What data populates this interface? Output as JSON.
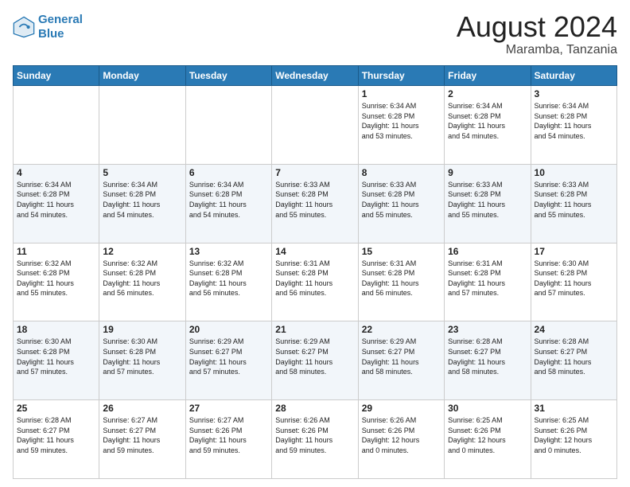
{
  "logo": {
    "line1": "General",
    "line2": "Blue"
  },
  "title": "August 2024",
  "location": "Maramba, Tanzania",
  "weekdays": [
    "Sunday",
    "Monday",
    "Tuesday",
    "Wednesday",
    "Thursday",
    "Friday",
    "Saturday"
  ],
  "weeks": [
    [
      {
        "day": "",
        "content": ""
      },
      {
        "day": "",
        "content": ""
      },
      {
        "day": "",
        "content": ""
      },
      {
        "day": "",
        "content": ""
      },
      {
        "day": "1",
        "content": "Sunrise: 6:34 AM\nSunset: 6:28 PM\nDaylight: 11 hours\nand 53 minutes."
      },
      {
        "day": "2",
        "content": "Sunrise: 6:34 AM\nSunset: 6:28 PM\nDaylight: 11 hours\nand 54 minutes."
      },
      {
        "day": "3",
        "content": "Sunrise: 6:34 AM\nSunset: 6:28 PM\nDaylight: 11 hours\nand 54 minutes."
      }
    ],
    [
      {
        "day": "4",
        "content": "Sunrise: 6:34 AM\nSunset: 6:28 PM\nDaylight: 11 hours\nand 54 minutes."
      },
      {
        "day": "5",
        "content": "Sunrise: 6:34 AM\nSunset: 6:28 PM\nDaylight: 11 hours\nand 54 minutes."
      },
      {
        "day": "6",
        "content": "Sunrise: 6:34 AM\nSunset: 6:28 PM\nDaylight: 11 hours\nand 54 minutes."
      },
      {
        "day": "7",
        "content": "Sunrise: 6:33 AM\nSunset: 6:28 PM\nDaylight: 11 hours\nand 55 minutes."
      },
      {
        "day": "8",
        "content": "Sunrise: 6:33 AM\nSunset: 6:28 PM\nDaylight: 11 hours\nand 55 minutes."
      },
      {
        "day": "9",
        "content": "Sunrise: 6:33 AM\nSunset: 6:28 PM\nDaylight: 11 hours\nand 55 minutes."
      },
      {
        "day": "10",
        "content": "Sunrise: 6:33 AM\nSunset: 6:28 PM\nDaylight: 11 hours\nand 55 minutes."
      }
    ],
    [
      {
        "day": "11",
        "content": "Sunrise: 6:32 AM\nSunset: 6:28 PM\nDaylight: 11 hours\nand 55 minutes."
      },
      {
        "day": "12",
        "content": "Sunrise: 6:32 AM\nSunset: 6:28 PM\nDaylight: 11 hours\nand 56 minutes."
      },
      {
        "day": "13",
        "content": "Sunrise: 6:32 AM\nSunset: 6:28 PM\nDaylight: 11 hours\nand 56 minutes."
      },
      {
        "day": "14",
        "content": "Sunrise: 6:31 AM\nSunset: 6:28 PM\nDaylight: 11 hours\nand 56 minutes."
      },
      {
        "day": "15",
        "content": "Sunrise: 6:31 AM\nSunset: 6:28 PM\nDaylight: 11 hours\nand 56 minutes."
      },
      {
        "day": "16",
        "content": "Sunrise: 6:31 AM\nSunset: 6:28 PM\nDaylight: 11 hours\nand 57 minutes."
      },
      {
        "day": "17",
        "content": "Sunrise: 6:30 AM\nSunset: 6:28 PM\nDaylight: 11 hours\nand 57 minutes."
      }
    ],
    [
      {
        "day": "18",
        "content": "Sunrise: 6:30 AM\nSunset: 6:28 PM\nDaylight: 11 hours\nand 57 minutes."
      },
      {
        "day": "19",
        "content": "Sunrise: 6:30 AM\nSunset: 6:28 PM\nDaylight: 11 hours\nand 57 minutes."
      },
      {
        "day": "20",
        "content": "Sunrise: 6:29 AM\nSunset: 6:27 PM\nDaylight: 11 hours\nand 57 minutes."
      },
      {
        "day": "21",
        "content": "Sunrise: 6:29 AM\nSunset: 6:27 PM\nDaylight: 11 hours\nand 58 minutes."
      },
      {
        "day": "22",
        "content": "Sunrise: 6:29 AM\nSunset: 6:27 PM\nDaylight: 11 hours\nand 58 minutes."
      },
      {
        "day": "23",
        "content": "Sunrise: 6:28 AM\nSunset: 6:27 PM\nDaylight: 11 hours\nand 58 minutes."
      },
      {
        "day": "24",
        "content": "Sunrise: 6:28 AM\nSunset: 6:27 PM\nDaylight: 11 hours\nand 58 minutes."
      }
    ],
    [
      {
        "day": "25",
        "content": "Sunrise: 6:28 AM\nSunset: 6:27 PM\nDaylight: 11 hours\nand 59 minutes."
      },
      {
        "day": "26",
        "content": "Sunrise: 6:27 AM\nSunset: 6:27 PM\nDaylight: 11 hours\nand 59 minutes."
      },
      {
        "day": "27",
        "content": "Sunrise: 6:27 AM\nSunset: 6:26 PM\nDaylight: 11 hours\nand 59 minutes."
      },
      {
        "day": "28",
        "content": "Sunrise: 6:26 AM\nSunset: 6:26 PM\nDaylight: 11 hours\nand 59 minutes."
      },
      {
        "day": "29",
        "content": "Sunrise: 6:26 AM\nSunset: 6:26 PM\nDaylight: 12 hours\nand 0 minutes."
      },
      {
        "day": "30",
        "content": "Sunrise: 6:25 AM\nSunset: 6:26 PM\nDaylight: 12 hours\nand 0 minutes."
      },
      {
        "day": "31",
        "content": "Sunrise: 6:25 AM\nSunset: 6:26 PM\nDaylight: 12 hours\nand 0 minutes."
      }
    ]
  ]
}
